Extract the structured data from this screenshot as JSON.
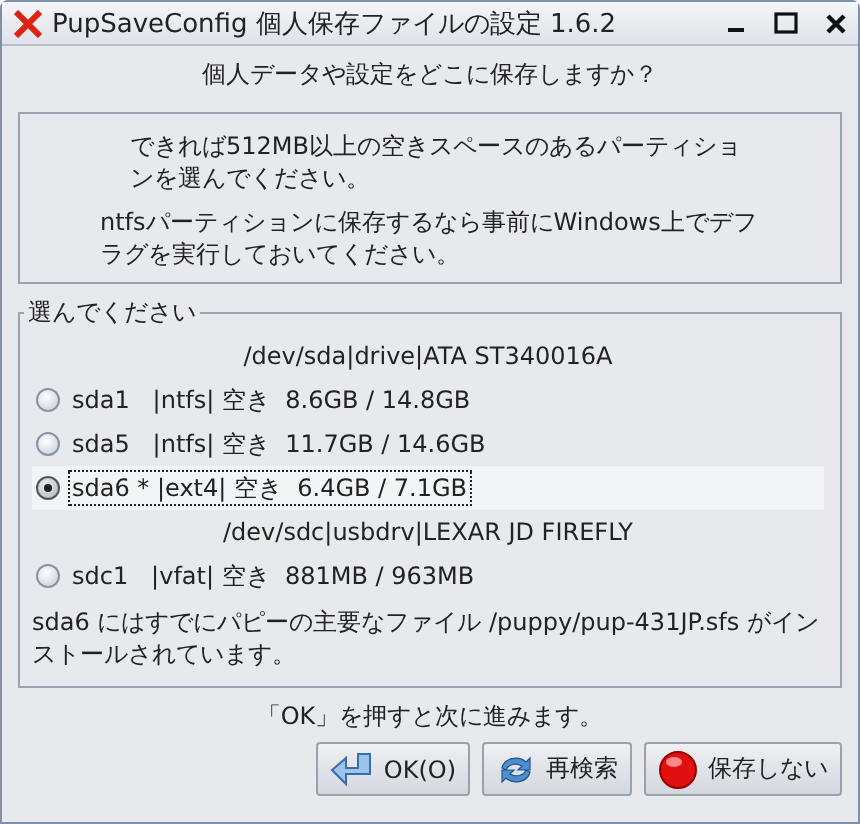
{
  "window": {
    "title": "PupSaveConfig 個人保存ファイルの設定 1.6.2"
  },
  "question": "個人データや設定をどこに保存しますか？",
  "info": [
    "できれば512MB以上の空きスペースのあるパーティションを選んでください。",
    "ntfsパーティションに保存するなら事前にWindows上でデフラグを実行しておいてください。"
  ],
  "group": {
    "label": "選んでください",
    "items": [
      {
        "kind": "device",
        "text": "/dev/sda|drive|ATA ST340016A"
      },
      {
        "kind": "partition",
        "text": "sda1   |ntfs| 空き  8.6GB / 14.8GB",
        "selected": false
      },
      {
        "kind": "partition",
        "text": "sda5   |ntfs| 空き  11.7GB / 14.6GB",
        "selected": false
      },
      {
        "kind": "partition",
        "text": "sda6 * |ext4| 空き  6.4GB / 7.1GB",
        "selected": true
      },
      {
        "kind": "device",
        "text": "/dev/sdc|usbdrv|LEXAR JD FIREFLY"
      },
      {
        "kind": "partition",
        "text": "sdc1   |vfat| 空き  881MB / 963MB",
        "selected": false
      }
    ],
    "note": "sda6 にはすでにパピーの主要なファイル /puppy/pup-431JP.sfs がインストールされています。"
  },
  "hint": "「OK」を押すと次に進みます。",
  "buttons": [
    {
      "kind": "ok",
      "label": "OK(O)"
    },
    {
      "kind": "rescan",
      "label": "再検索"
    },
    {
      "kind": "nosave",
      "label": "保存しない"
    }
  ]
}
